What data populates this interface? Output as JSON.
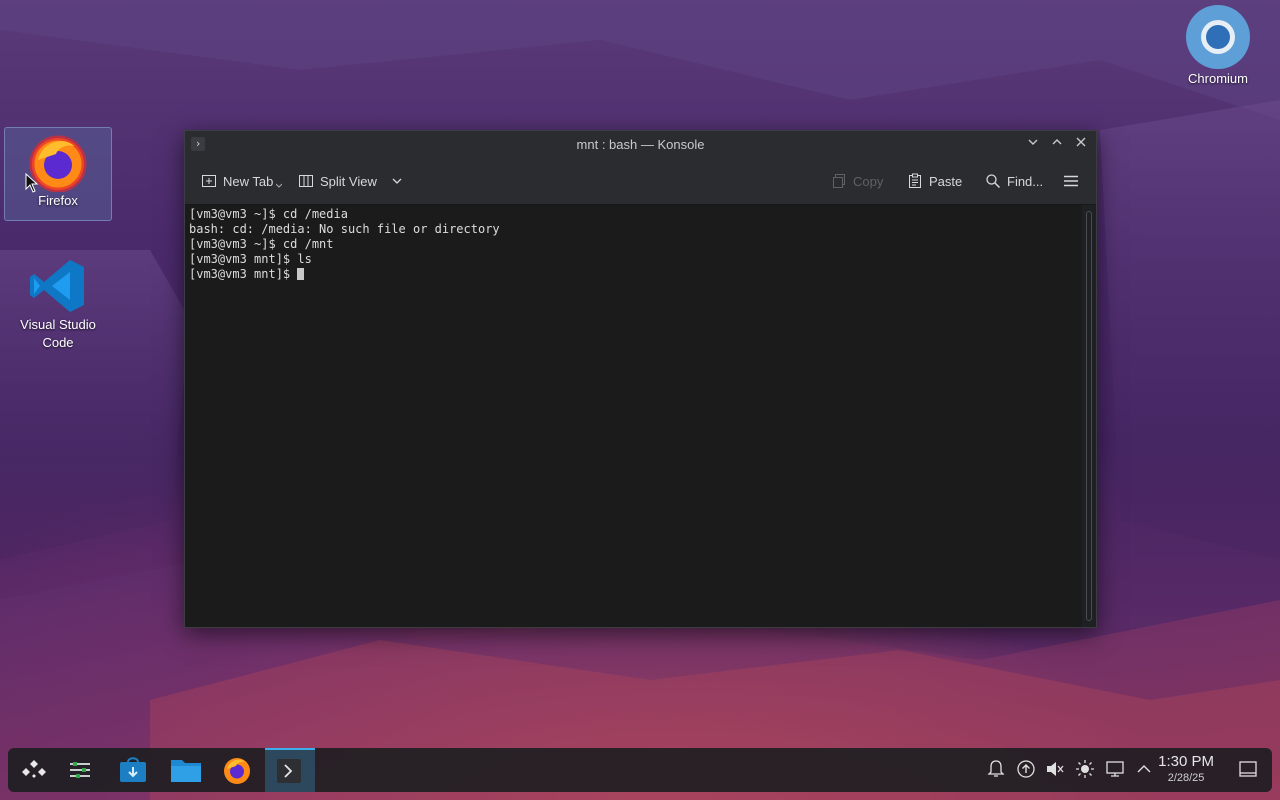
{
  "desktop": {
    "icons": [
      {
        "label": "Firefox"
      },
      {
        "label": "Visual Studio Code"
      },
      {
        "label": "Chromium"
      }
    ]
  },
  "window": {
    "title": "mnt : bash — Konsole",
    "toolbar": {
      "new_tab": "New Tab",
      "split_view": "Split View",
      "copy": "Copy",
      "paste": "Paste",
      "find": "Find..."
    },
    "terminal_lines": [
      "[vm3@vm3 ~]$ cd /media",
      "bash: cd: /media: No such file or directory",
      "[vm3@vm3 ~]$ cd /mnt",
      "[vm3@vm3 mnt]$ ls",
      "[vm3@vm3 mnt]$ "
    ]
  },
  "taskbar": {
    "clock": {
      "time": "1:30 PM",
      "date": "2/28/25"
    },
    "apps": [
      "application-launcher-icon",
      "system-settings-icon",
      "discover-icon",
      "file-manager-icon",
      "firefox-icon",
      "konsole-icon"
    ],
    "tray": [
      "notifications-icon",
      "updates-icon",
      "volume-muted-icon",
      "brightness-icon",
      "network-icon",
      "tray-expand-icon",
      "show-desktop-icon"
    ]
  },
  "colors": {
    "accent": "#3daee9",
    "terminal_bg": "#1b1b1b",
    "window_chrome": "#2a2c30"
  }
}
